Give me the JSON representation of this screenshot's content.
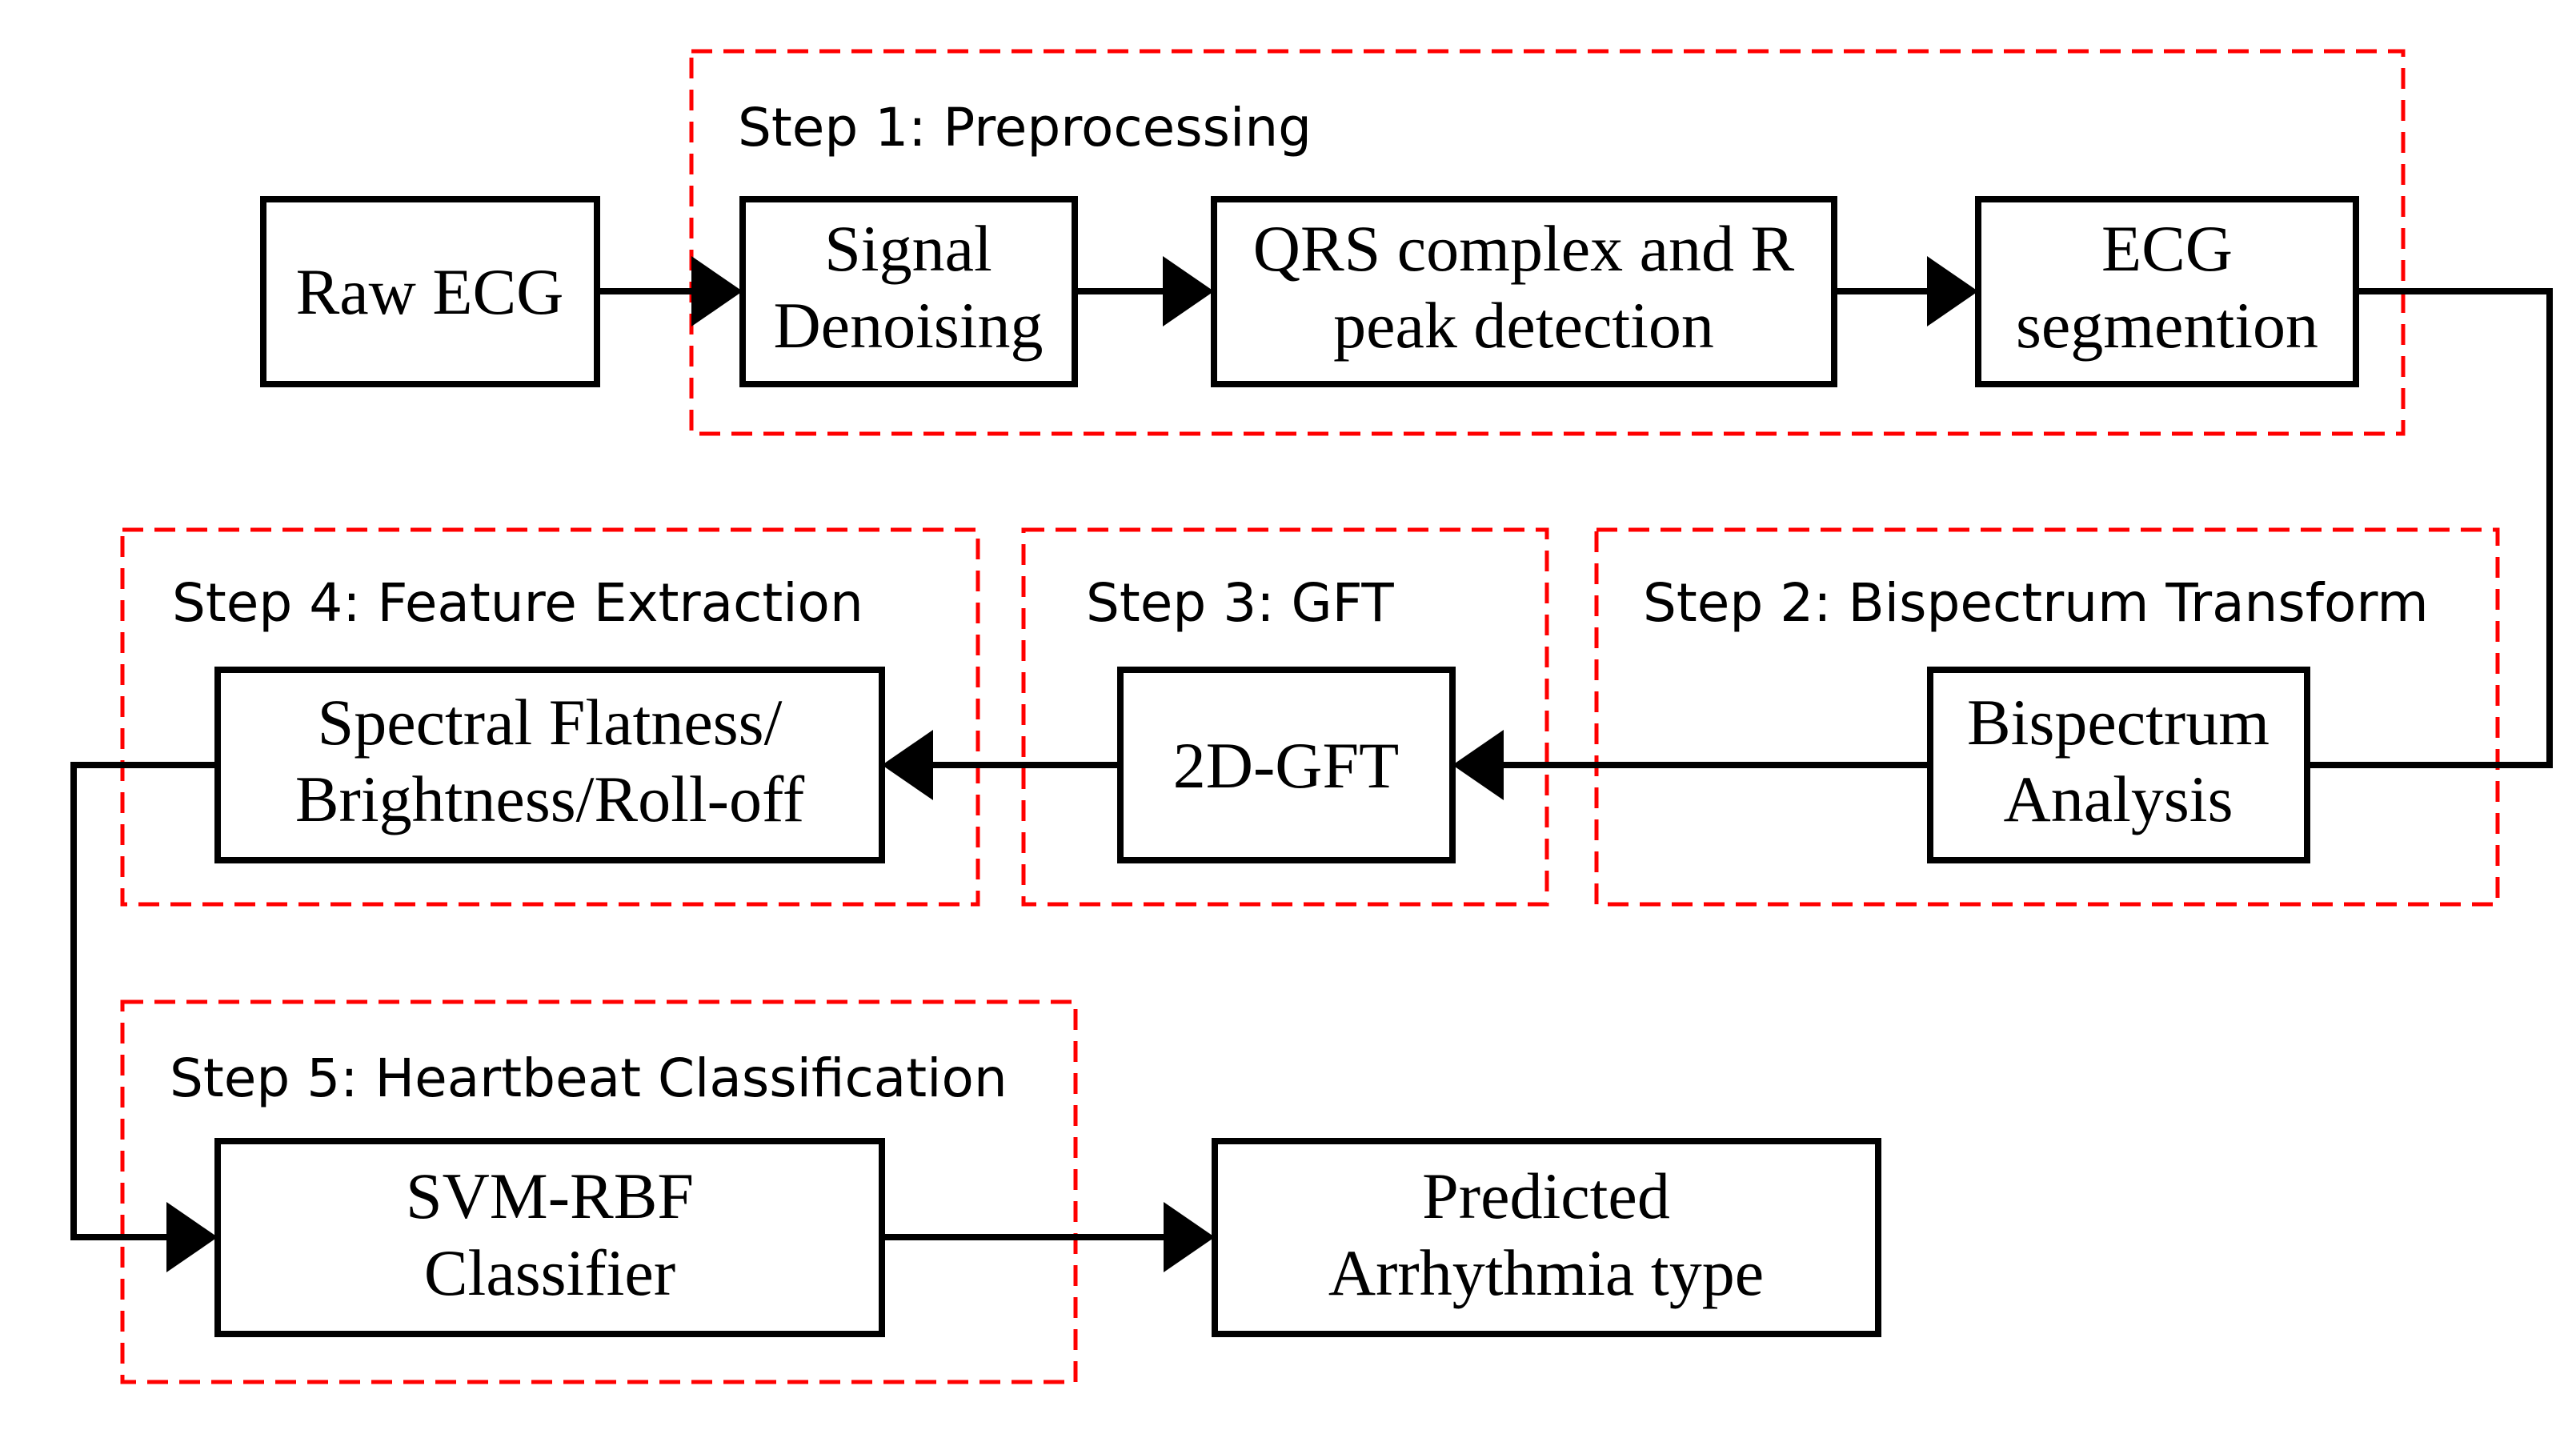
{
  "colors": {
    "group_border": "#ff0000",
    "box_border": "#000000",
    "arrow": "#000000",
    "background": "#ffffff"
  },
  "groups": [
    {
      "id": "step1",
      "label": "Step 1: Preprocessing"
    },
    {
      "id": "step2",
      "label": "Step 2: Bispectrum Transform"
    },
    {
      "id": "step3",
      "label": "Step 3: GFT"
    },
    {
      "id": "step4",
      "label": "Step 4: Feature Extraction"
    },
    {
      "id": "step5",
      "label": "Step 5: Heartbeat Classification"
    }
  ],
  "nodes": [
    {
      "id": "raw-ecg",
      "lines": [
        "Raw ECG"
      ]
    },
    {
      "id": "signal-denoising",
      "lines": [
        "Signal",
        "Denoising"
      ]
    },
    {
      "id": "qrs-detection",
      "lines": [
        "QRS complex and R",
        "peak detection"
      ]
    },
    {
      "id": "ecg-segmentation",
      "lines": [
        "ECG",
        "segmention"
      ]
    },
    {
      "id": "bispectrum-analysis",
      "lines": [
        "Bispectrum",
        "Analysis"
      ]
    },
    {
      "id": "2d-gft",
      "lines": [
        "2D-GFT"
      ]
    },
    {
      "id": "spectral-features",
      "lines": [
        "Spectral Flatness/",
        "Brightness/Roll-off"
      ]
    },
    {
      "id": "svm-rbf",
      "lines": [
        "SVM-RBF",
        "Classifier"
      ]
    },
    {
      "id": "predicted-type",
      "lines": [
        "Predicted",
        "Arrhythmia type"
      ]
    }
  ],
  "edges": [
    {
      "from": "raw-ecg",
      "to": "signal-denoising"
    },
    {
      "from": "signal-denoising",
      "to": "qrs-detection"
    },
    {
      "from": "qrs-detection",
      "to": "ecg-segmentation"
    },
    {
      "from": "ecg-segmentation",
      "to": "bispectrum-analysis"
    },
    {
      "from": "bispectrum-analysis",
      "to": "2d-gft"
    },
    {
      "from": "2d-gft",
      "to": "spectral-features"
    },
    {
      "from": "spectral-features",
      "to": "svm-rbf"
    },
    {
      "from": "svm-rbf",
      "to": "predicted-type"
    }
  ]
}
